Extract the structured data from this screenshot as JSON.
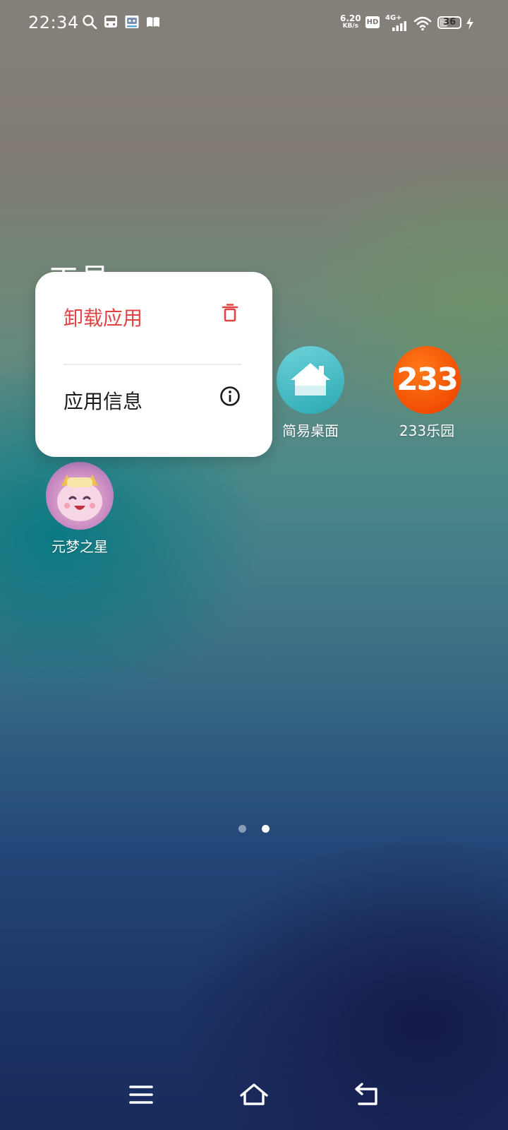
{
  "status_bar": {
    "time": "22:34",
    "net_speed_value": "6.20",
    "net_speed_unit": "KB/s",
    "hd_badge": "HD",
    "network": "4G+",
    "battery_level": "36",
    "left_icons": [
      "search-icon",
      "bus-icon",
      "robot-app-icon",
      "book-icon"
    ],
    "right_icons": [
      "signal-icon",
      "wifi-icon",
      "battery-icon",
      "charging-icon"
    ]
  },
  "folder": {
    "title": "工具"
  },
  "context_menu": {
    "items": [
      {
        "label": "卸载应用",
        "icon": "trash-icon",
        "color": "#e04343"
      },
      {
        "label": "应用信息",
        "icon": "info-icon",
        "color": "#1a1a1a"
      }
    ]
  },
  "apps": [
    {
      "label": "简易桌面",
      "icon": "home-app-icon"
    },
    {
      "label": "233乐园",
      "icon": "233-app-icon",
      "icon_text": "233"
    },
    {
      "label": "元梦之星",
      "icon": "yuanmeng-app-icon"
    }
  ],
  "page_indicator": {
    "pages": 2,
    "current": 2
  },
  "nav_bar": {
    "buttons": [
      "menu-icon",
      "home-icon",
      "back-icon"
    ]
  }
}
